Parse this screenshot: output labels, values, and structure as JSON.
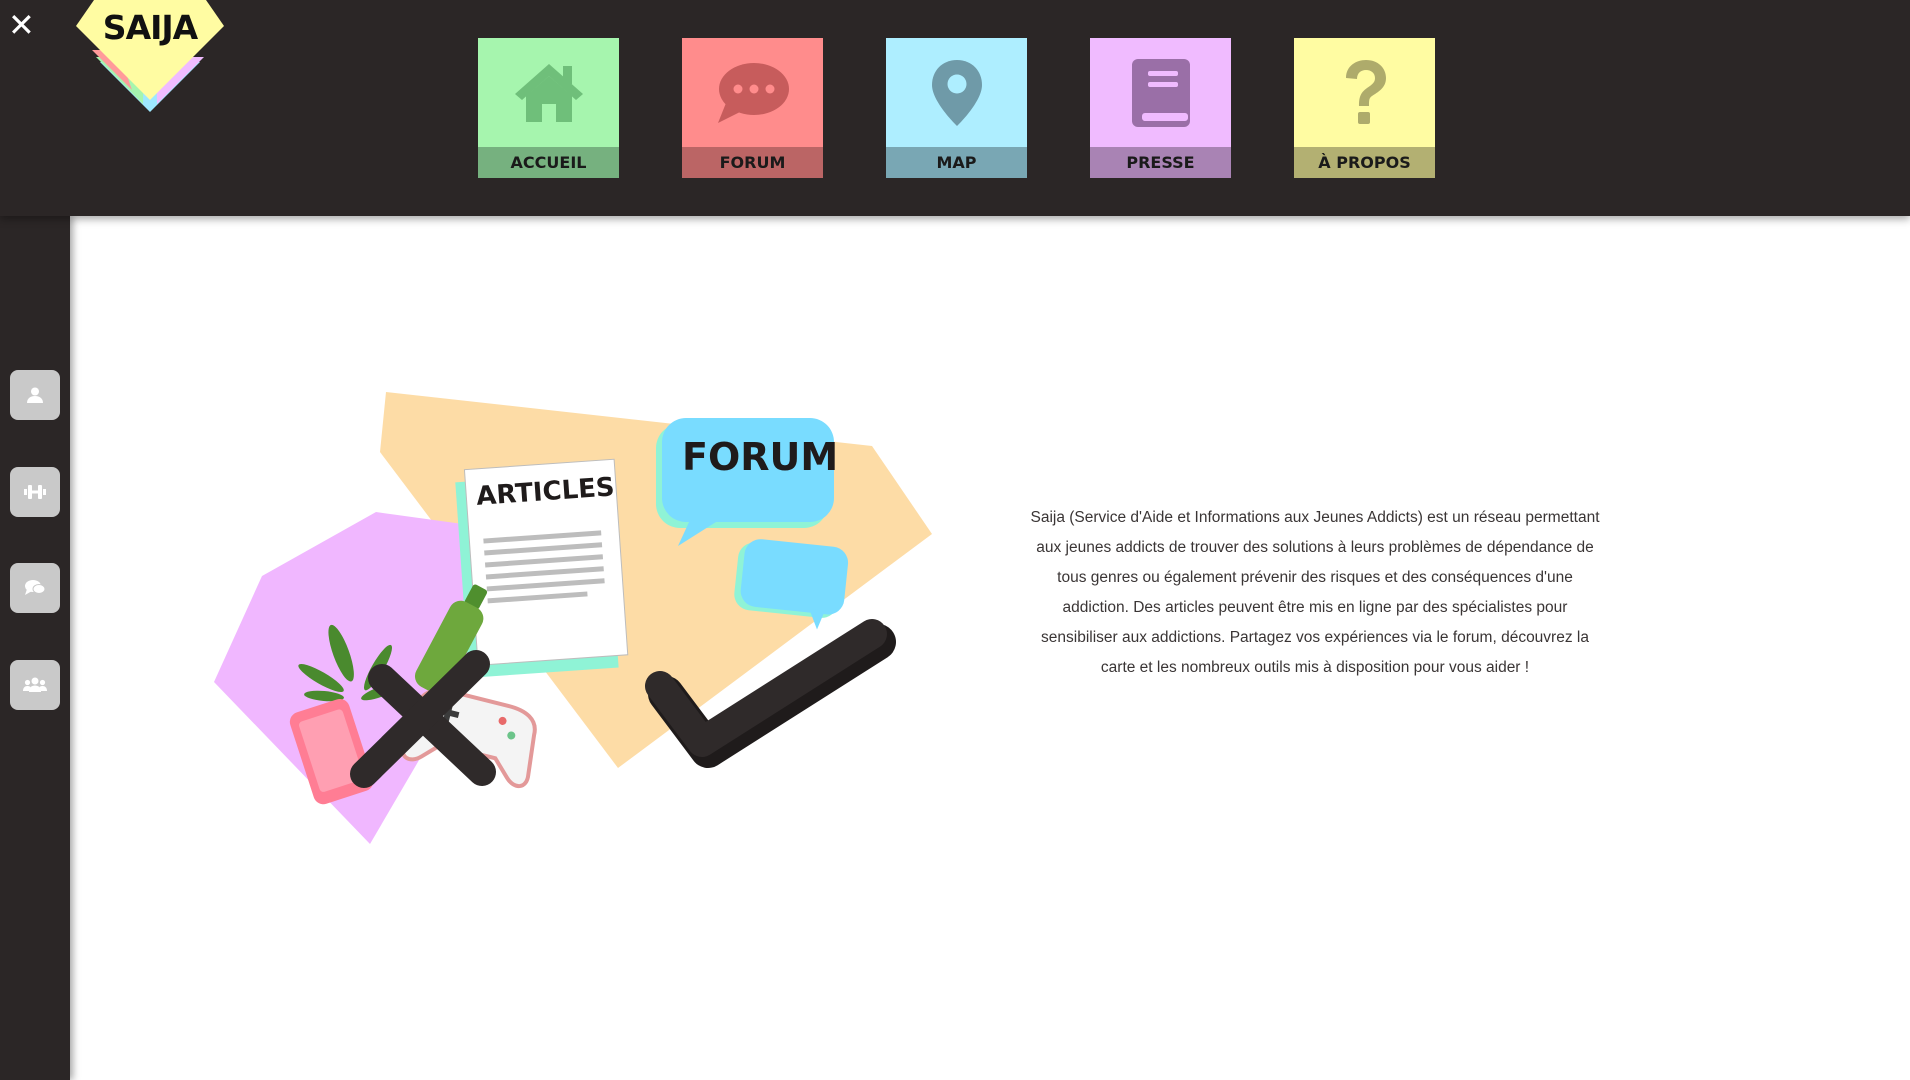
{
  "header": {
    "close_icon": "close-icon",
    "logo_text": "SAIJA",
    "colors": {
      "background": "#2b2626"
    }
  },
  "nav": {
    "items": [
      {
        "label": "ACCUEIL",
        "icon": "home-icon",
        "bg": "#a6f5ae",
        "band": "#76b17f",
        "fg": "#6fbf7a"
      },
      {
        "label": "FORUM",
        "icon": "chat-bubble-icon",
        "bg": "#ff8c8c",
        "band": "#bb6565",
        "fg": "#c75c5c"
      },
      {
        "label": "MAP",
        "icon": "map-pin-icon",
        "bg": "#aeeeff",
        "band": "#79a7b4",
        "fg": "#6f9aa8"
      },
      {
        "label": "PRESSE",
        "icon": "book-icon",
        "bg": "#f0bbff",
        "band": "#a983b4",
        "fg": "#9a6fa7"
      },
      {
        "label": "À PROPOS",
        "icon": "question-mark-icon",
        "bg": "#fffca2",
        "band": "#b3b072",
        "fg": "#aeab6b"
      }
    ]
  },
  "sidebar": {
    "buttons": [
      {
        "name": "user-button",
        "icon": "user-icon"
      },
      {
        "name": "fitness-button",
        "icon": "dumbbell-icon"
      },
      {
        "name": "chat-button",
        "icon": "chat-icon"
      },
      {
        "name": "group-button",
        "icon": "users-icon"
      }
    ]
  },
  "hero": {
    "articles_label": "ARTICLES",
    "forum_label": "FORUM"
  },
  "main": {
    "description": "Saija (Service d'Aide et Informations aux Jeunes Addicts) est un réseau permettant aux jeunes addicts de trouver des solutions à leurs problèmes de dépendance de tous genres ou également prévenir des risques et des conséquences d'une addiction. Des articles peuvent être mis en ligne par des spécialistes pour sensibiliser aux addictions. Partagez vos expériences via le forum, découvrez la carte et les nombreux outils mis à disposition pour vous aider !"
  }
}
